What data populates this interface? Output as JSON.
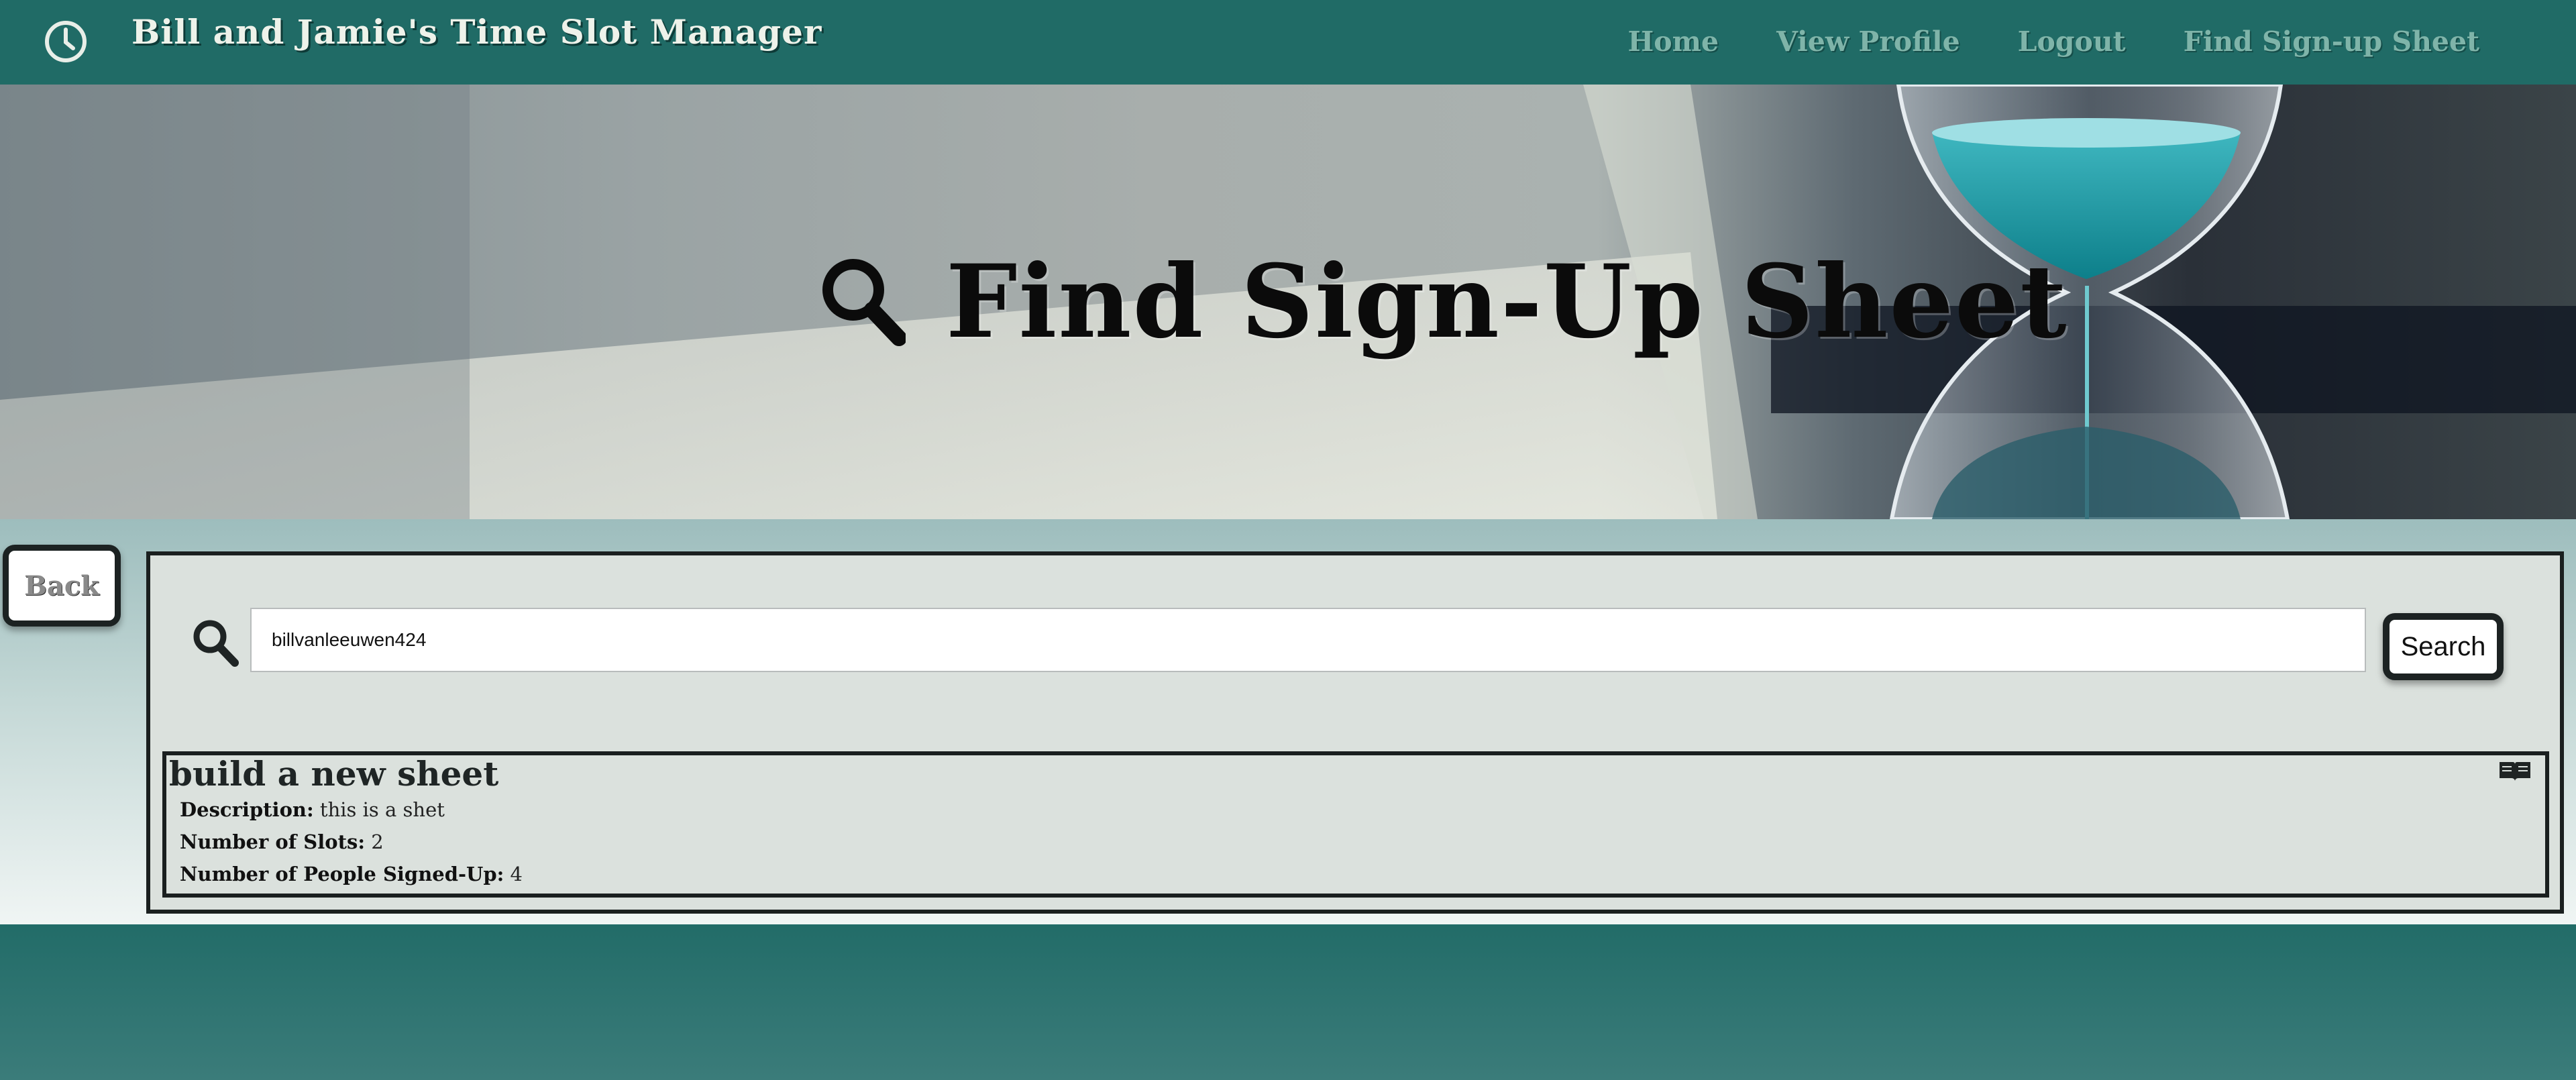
{
  "navbar": {
    "brand_title": "Bill and Jamie's Time Slot Manager",
    "links": [
      "Home",
      "View Profile",
      "Logout",
      "Find Sign-up Sheet"
    ]
  },
  "hero": {
    "title": "Find Sign-Up Sheet"
  },
  "back_button": {
    "label": "Back"
  },
  "search": {
    "value": "billvanleeuwen424",
    "button_label": "Search"
  },
  "sheet": {
    "title": "build a new sheet",
    "description_label": "Description:",
    "description": "this is a shet",
    "slots_label": "Number of Slots:",
    "slots": "2",
    "signed_label": "Number of People Signed-Up:",
    "signed": "4"
  },
  "colors": {
    "navbar": "#206b66",
    "nav_link": "#7fb4a9",
    "panel_bg": "#dbe1dd",
    "border": "#1a1f1f",
    "accent_teal": "#1aa3a8"
  },
  "icons": [
    "clock-icon",
    "search-icon",
    "book-icon"
  ]
}
